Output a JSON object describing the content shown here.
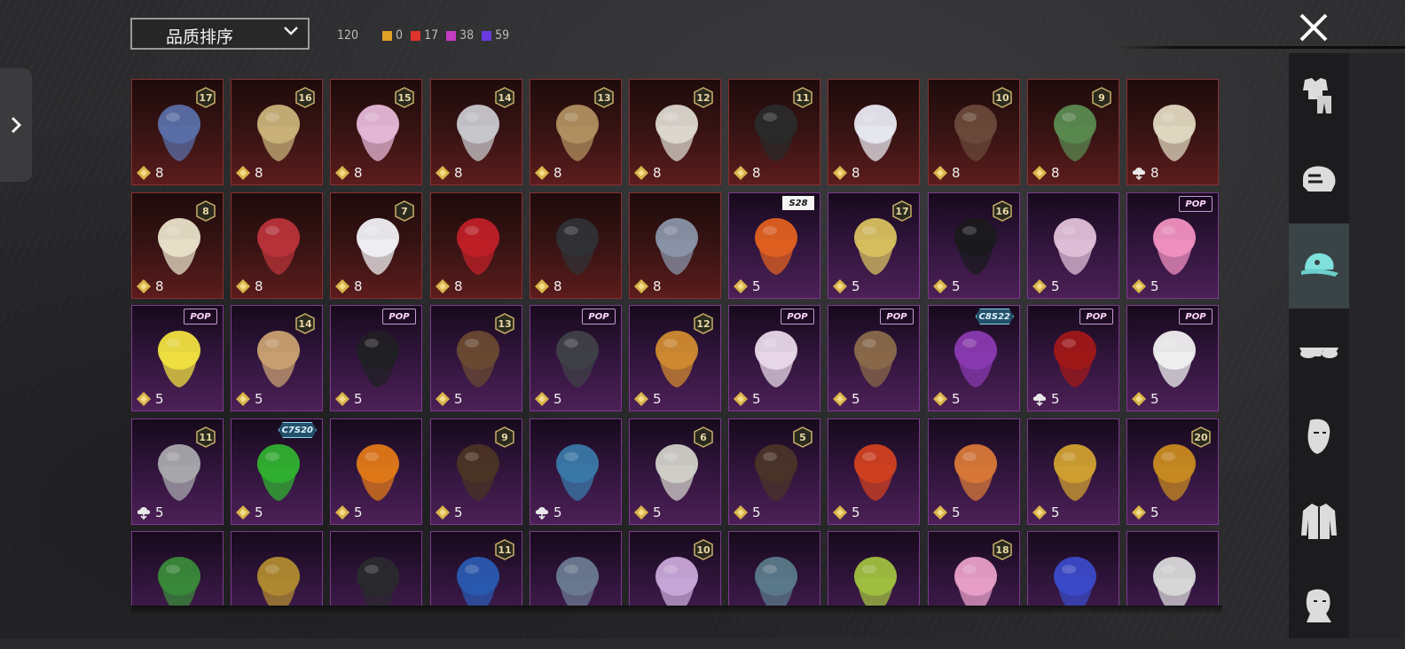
{
  "sort": {
    "label": "品质排序"
  },
  "counts": {
    "total": "120",
    "gold": "0",
    "red": "17",
    "pink": "38",
    "purple": "59",
    "gold_color": "#e0a028",
    "red_color": "#e0332a",
    "pink_color": "#c43bc4",
    "purple_color": "#6a3ae0"
  },
  "sidebar": {
    "items": [
      {
        "name": "outfit",
        "icon": "outfit-icon",
        "active": false
      },
      {
        "name": "mask",
        "icon": "helmet-mask-icon",
        "active": false
      },
      {
        "name": "hat",
        "icon": "cap-icon",
        "active": true
      },
      {
        "name": "glasses",
        "icon": "sunglasses-icon",
        "active": false
      },
      {
        "name": "face",
        "icon": "face-icon",
        "active": false
      },
      {
        "name": "top",
        "icon": "jacket-icon",
        "active": false
      },
      {
        "name": "emote",
        "icon": "bust-icon",
        "active": false
      }
    ]
  },
  "items": [
    {
      "rarity": "red",
      "level": "17",
      "badge": "",
      "cost": "8",
      "cost_icon": "diamond",
      "art": "#5a6fa8"
    },
    {
      "rarity": "red",
      "level": "16",
      "badge": "",
      "cost": "8",
      "cost_icon": "diamond",
      "art": "#c9b27a"
    },
    {
      "rarity": "red",
      "level": "15",
      "badge": "",
      "cost": "8",
      "cost_icon": "diamond",
      "art": "#e5b8d8"
    },
    {
      "rarity": "red",
      "level": "14",
      "badge": "",
      "cost": "8",
      "cost_icon": "diamond",
      "art": "#c8c8cc"
    },
    {
      "rarity": "red",
      "level": "13",
      "badge": "",
      "cost": "8",
      "cost_icon": "diamond",
      "art": "#b09060"
    },
    {
      "rarity": "red",
      "level": "12",
      "badge": "",
      "cost": "8",
      "cost_icon": "diamond",
      "art": "#ddd8d0"
    },
    {
      "rarity": "red",
      "level": "11",
      "badge": "",
      "cost": "8",
      "cost_icon": "diamond",
      "art": "#2a2a2a"
    },
    {
      "rarity": "red",
      "level": "",
      "badge": "",
      "cost": "8",
      "cost_icon": "diamond",
      "art": "#e8e8f0"
    },
    {
      "rarity": "red",
      "level": "10",
      "badge": "",
      "cost": "8",
      "cost_icon": "diamond",
      "art": "#6a4a3a"
    },
    {
      "rarity": "red",
      "level": "9",
      "badge": "",
      "cost": "8",
      "cost_icon": "diamond",
      "art": "#5a8a50"
    },
    {
      "rarity": "red",
      "level": "",
      "badge": "",
      "cost": "8",
      "cost_icon": "cloud",
      "art": "#e0d8c0"
    },
    {
      "rarity": "red",
      "level": "8",
      "badge": "",
      "cost": "8",
      "cost_icon": "diamond",
      "art": "#e8e0c8"
    },
    {
      "rarity": "red",
      "level": "",
      "badge": "",
      "cost": "8",
      "cost_icon": "diamond",
      "art": "#b8343a"
    },
    {
      "rarity": "red",
      "level": "7",
      "badge": "",
      "cost": "8",
      "cost_icon": "diamond",
      "art": "#f0f0f4"
    },
    {
      "rarity": "red",
      "level": "",
      "badge": "",
      "cost": "8",
      "cost_icon": "diamond",
      "art": "#c02028"
    },
    {
      "rarity": "red",
      "level": "",
      "badge": "",
      "cost": "8",
      "cost_icon": "diamond",
      "art": "#303236"
    },
    {
      "rarity": "red",
      "level": "",
      "badge": "",
      "cost": "8",
      "cost_icon": "diamond",
      "art": "#8a94a8"
    },
    {
      "rarity": "purple",
      "level": "",
      "badge": "S28",
      "cost": "5",
      "cost_icon": "diamond",
      "art": "#e06020"
    },
    {
      "rarity": "purple",
      "level": "17",
      "badge": "",
      "cost": "5",
      "cost_icon": "diamond",
      "art": "#d8c060"
    },
    {
      "rarity": "purple",
      "level": "16",
      "badge": "",
      "cost": "5",
      "cost_icon": "diamond",
      "art": "#1a1a1e"
    },
    {
      "rarity": "purple",
      "level": "",
      "badge": "",
      "cost": "5",
      "cost_icon": "diamond",
      "art": "#e0c0d8"
    },
    {
      "rarity": "purple",
      "level": "",
      "badge": "POP",
      "cost": "5",
      "cost_icon": "diamond",
      "art": "#f090c0"
    },
    {
      "rarity": "purple",
      "level": "",
      "badge": "POP",
      "cost": "5",
      "cost_icon": "diamond",
      "art": "#f0e040"
    },
    {
      "rarity": "purple",
      "level": "14",
      "badge": "",
      "cost": "5",
      "cost_icon": "diamond",
      "art": "#c8a070"
    },
    {
      "rarity": "purple",
      "level": "",
      "badge": "POP",
      "cost": "5",
      "cost_icon": "diamond",
      "art": "#202024"
    },
    {
      "rarity": "purple",
      "level": "13",
      "badge": "",
      "cost": "5",
      "cost_icon": "diamond",
      "art": "#6a4a32"
    },
    {
      "rarity": "purple",
      "level": "",
      "badge": "POP",
      "cost": "5",
      "cost_icon": "diamond",
      "art": "#404048"
    },
    {
      "rarity": "purple",
      "level": "12",
      "badge": "",
      "cost": "5",
      "cost_icon": "diamond",
      "art": "#d08a30"
    },
    {
      "rarity": "purple",
      "level": "",
      "badge": "POP",
      "cost": "5",
      "cost_icon": "diamond",
      "art": "#e8d8e8"
    },
    {
      "rarity": "purple",
      "level": "",
      "badge": "POP",
      "cost": "5",
      "cost_icon": "diamond",
      "art": "#8a6a4a"
    },
    {
      "rarity": "purple",
      "level": "",
      "badge": "C8S22",
      "cost": "5",
      "cost_icon": "diamond",
      "art": "#8a3ab0"
    },
    {
      "rarity": "purple",
      "level": "",
      "badge": "POP",
      "cost": "5",
      "cost_icon": "cloud",
      "art": "#a01818"
    },
    {
      "rarity": "purple",
      "level": "",
      "badge": "POP",
      "cost": "5",
      "cost_icon": "diamond",
      "art": "#f0f0f0"
    },
    {
      "rarity": "purple",
      "level": "11",
      "badge": "",
      "cost": "5",
      "cost_icon": "cloud",
      "art": "#a8a8ac"
    },
    {
      "rarity": "purple",
      "level": "",
      "badge": "C7S20",
      "cost": "5",
      "cost_icon": "diamond",
      "art": "#30b030"
    },
    {
      "rarity": "purple",
      "level": "",
      "badge": "",
      "cost": "5",
      "cost_icon": "diamond",
      "art": "#e07818"
    },
    {
      "rarity": "purple",
      "level": "9",
      "badge": "",
      "cost": "5",
      "cost_icon": "diamond",
      "art": "#4a3424"
    },
    {
      "rarity": "purple",
      "level": "",
      "badge": "",
      "cost": "5",
      "cost_icon": "cloud",
      "art": "#3a78a8"
    },
    {
      "rarity": "purple",
      "level": "6",
      "badge": "",
      "cost": "5",
      "cost_icon": "diamond",
      "art": "#d0d0c8"
    },
    {
      "rarity": "purple",
      "level": "5",
      "badge": "",
      "cost": "5",
      "cost_icon": "diamond",
      "art": "#4a3428"
    },
    {
      "rarity": "purple",
      "level": "",
      "badge": "",
      "cost": "5",
      "cost_icon": "diamond",
      "art": "#d04020"
    },
    {
      "rarity": "purple",
      "level": "",
      "badge": "",
      "cost": "5",
      "cost_icon": "diamond",
      "art": "#d87838"
    },
    {
      "rarity": "purple",
      "level": "",
      "badge": "",
      "cost": "5",
      "cost_icon": "diamond",
      "art": "#d0a030"
    },
    {
      "rarity": "purple",
      "level": "20",
      "badge": "",
      "cost": "5",
      "cost_icon": "diamond",
      "art": "#c88a20"
    },
    {
      "rarity": "purple",
      "level": "",
      "badge": "",
      "cost": "",
      "cost_icon": "",
      "art": "#3a8a3a"
    },
    {
      "rarity": "purple",
      "level": "",
      "badge": "",
      "cost": "",
      "cost_icon": "",
      "art": "#b08a30"
    },
    {
      "rarity": "purple",
      "level": "",
      "badge": "",
      "cost": "",
      "cost_icon": "",
      "art": "#2a2a2e"
    },
    {
      "rarity": "purple",
      "level": "11",
      "badge": "",
      "cost": "",
      "cost_icon": "",
      "art": "#2a5ab0"
    },
    {
      "rarity": "purple",
      "level": "",
      "badge": "",
      "cost": "",
      "cost_icon": "",
      "art": "#6a7a90"
    },
    {
      "rarity": "purple",
      "level": "10",
      "badge": "",
      "cost": "",
      "cost_icon": "",
      "art": "#c8a8d8"
    },
    {
      "rarity": "purple",
      "level": "",
      "badge": "",
      "cost": "",
      "cost_icon": "",
      "art": "#5a7a8a"
    },
    {
      "rarity": "purple",
      "level": "",
      "badge": "",
      "cost": "",
      "cost_icon": "",
      "art": "#a0c040"
    },
    {
      "rarity": "purple",
      "level": "18",
      "badge": "",
      "cost": "",
      "cost_icon": "",
      "art": "#e8a0c8"
    },
    {
      "rarity": "purple",
      "level": "",
      "badge": "",
      "cost": "",
      "cost_icon": "",
      "art": "#3a4ac8"
    },
    {
      "rarity": "purple",
      "level": "",
      "badge": "",
      "cost": "",
      "cost_icon": "",
      "art": "#d8d8d8"
    }
  ]
}
